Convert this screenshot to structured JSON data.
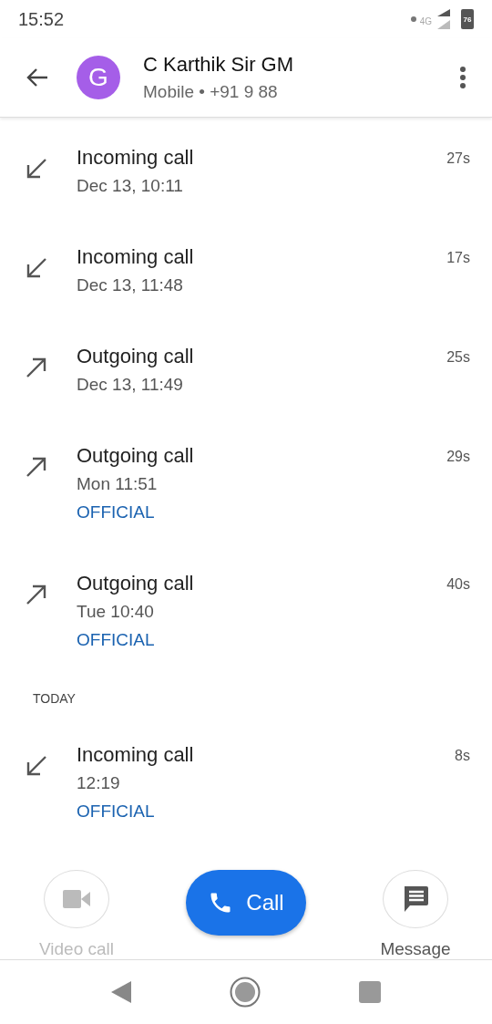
{
  "status_bar": {
    "time": "15:52",
    "network": "4G",
    "battery": "76"
  },
  "header": {
    "avatar_letter": "G",
    "name": "C Karthik Sir GM",
    "subtitle": "Mobile • +91 9 88"
  },
  "sections": [
    {
      "calls": [
        {
          "kind": "incoming",
          "title": "Incoming call",
          "time": "Dec 13, 10:11",
          "duration": "27s"
        },
        {
          "kind": "incoming",
          "title": "Incoming call",
          "time": "Dec 13, 11:48",
          "duration": "17s"
        },
        {
          "kind": "outgoing",
          "title": "Outgoing call",
          "time": "Dec 13, 11:49",
          "duration": "25s"
        },
        {
          "kind": "outgoing",
          "title": "Outgoing call",
          "time": "Mon 11:51",
          "duration": "29s",
          "label": "OFFICIAL"
        },
        {
          "kind": "outgoing",
          "title": "Outgoing call",
          "time": "Tue 10:40",
          "duration": "40s",
          "label": "OFFICIAL"
        }
      ]
    },
    {
      "header": "TODAY",
      "calls": [
        {
          "kind": "incoming",
          "title": "Incoming call",
          "time": "12:19",
          "duration": "8s",
          "label": "OFFICIAL"
        }
      ]
    }
  ],
  "actions": [
    {
      "kind": "video",
      "label": "Video call",
      "disabled": true
    },
    {
      "kind": "call",
      "label": "Call",
      "disabled": false
    },
    {
      "kind": "message",
      "label": "Message",
      "disabled": false
    }
  ]
}
